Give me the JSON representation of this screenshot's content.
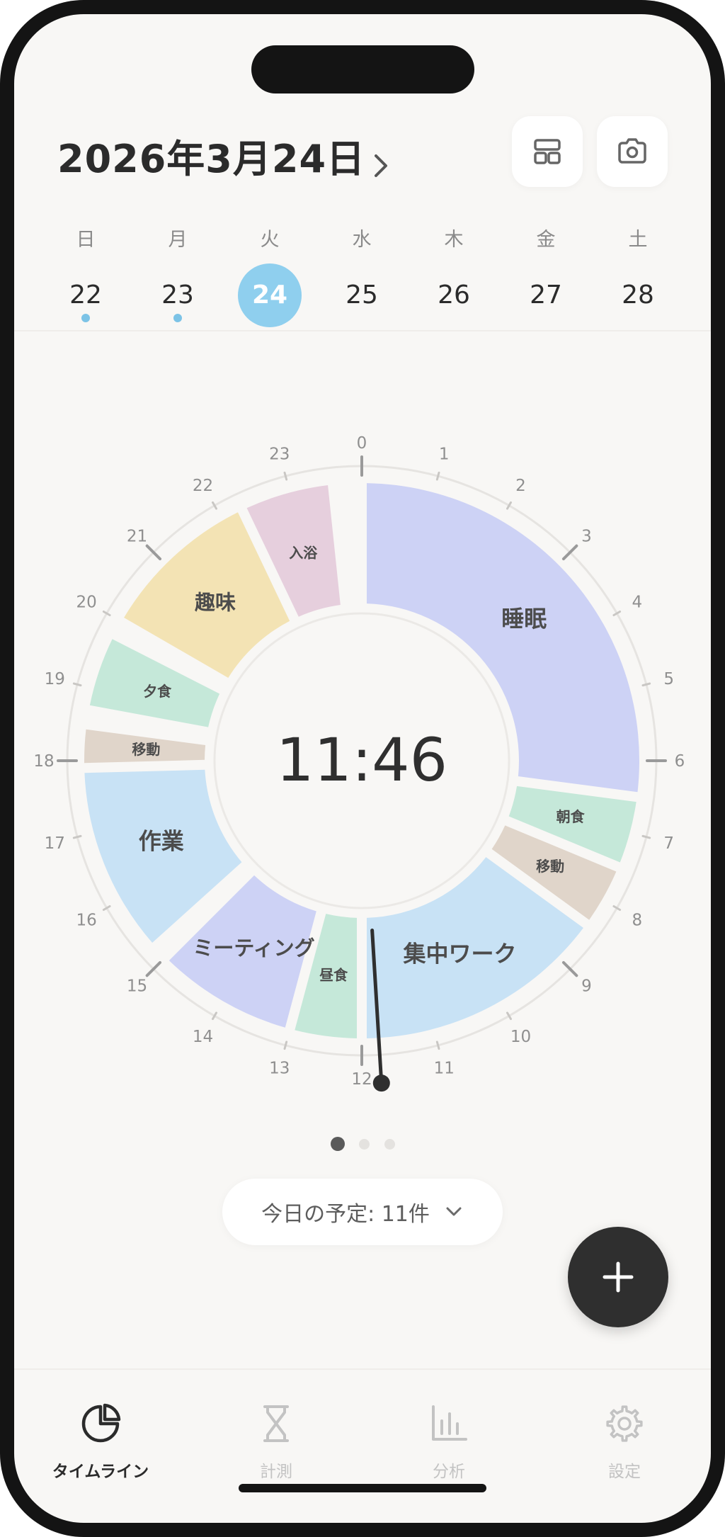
{
  "header": {
    "date_title": "2026年3月24日",
    "next_icon": "chevron-right-icon",
    "layout_button_icon": "layout-icon",
    "camera_button_icon": "camera-icon"
  },
  "week": {
    "days": [
      {
        "weekday": "日",
        "date": "22",
        "selected": false,
        "has_entries": true
      },
      {
        "weekday": "月",
        "date": "23",
        "selected": false,
        "has_entries": true
      },
      {
        "weekday": "火",
        "date": "24",
        "selected": true,
        "has_entries": false
      },
      {
        "weekday": "水",
        "date": "25",
        "selected": false,
        "has_entries": false
      },
      {
        "weekday": "木",
        "date": "26",
        "selected": false,
        "has_entries": false
      },
      {
        "weekday": "金",
        "date": "27",
        "selected": false,
        "has_entries": false
      },
      {
        "weekday": "土",
        "date": "28",
        "selected": false,
        "has_entries": false
      }
    ],
    "selected_color": "#8fcfee",
    "dot_color": "#7cc3e6"
  },
  "clock": {
    "current_time": "11:46",
    "current_hour_decimal": 11.767,
    "hour_labels": [
      "0",
      "1",
      "2",
      "3",
      "4",
      "5",
      "6",
      "7",
      "8",
      "9",
      "10",
      "11",
      "12",
      "13",
      "14",
      "15",
      "16",
      "17",
      "18",
      "19",
      "20",
      "21",
      "22",
      "23"
    ],
    "activities": [
      {
        "label": "睡眠",
        "start": 0.0,
        "end": 6.5,
        "color": "#cdd2f5"
      },
      {
        "label": "朝食",
        "start": 6.5,
        "end": 7.5,
        "color": "#c5e8d9"
      },
      {
        "label": "移動",
        "start": 7.5,
        "end": 8.4,
        "color": "#e0d5ca"
      },
      {
        "label": "集中ワーク",
        "start": 8.4,
        "end": 12.0,
        "color": "#c8e2f5"
      },
      {
        "label": "昼食",
        "start": 12.0,
        "end": 13.0,
        "color": "#c5e8d9"
      },
      {
        "label": "ミーティング",
        "start": 13.0,
        "end": 15.0,
        "color": "#cdd2f5"
      },
      {
        "label": "作業",
        "start": 15.2,
        "end": 17.9,
        "color": "#c8e2f5"
      },
      {
        "label": "移動",
        "start": 17.9,
        "end": 18.5,
        "color": "#e0d5ca"
      },
      {
        "label": "夕食",
        "start": 18.7,
        "end": 19.8,
        "color": "#c5e8d9"
      },
      {
        "label": "趣味",
        "start": 20.0,
        "end": 22.3,
        "color": "#f3e3b4"
      },
      {
        "label": "入浴",
        "start": 22.3,
        "end": 23.6,
        "color": "#e6cfdd"
      }
    ]
  },
  "pager": {
    "count": 3,
    "active": 0
  },
  "today_summary": {
    "label": "今日の予定: 11件",
    "icon": "chevron-down-icon"
  },
  "fab": {
    "icon": "plus-icon"
  },
  "tabs": [
    {
      "label": "タイムライン",
      "icon": "pie-chart-icon",
      "active": true
    },
    {
      "label": "計測",
      "icon": "hourglass-icon",
      "active": false
    },
    {
      "label": "分析",
      "icon": "bar-chart-icon",
      "active": false
    },
    {
      "label": "設定",
      "icon": "gear-icon",
      "active": false
    }
  ]
}
